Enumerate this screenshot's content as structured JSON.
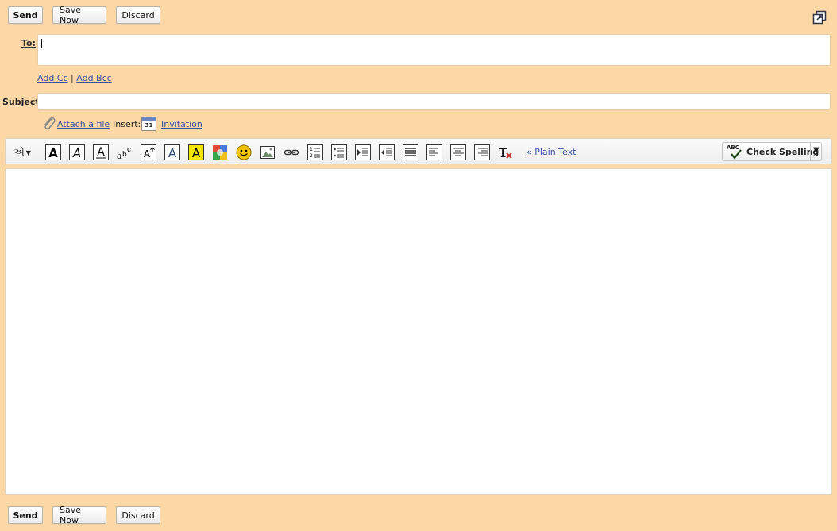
{
  "actions": {
    "send": "Send",
    "save_now": "Save Now",
    "discard": "Discard"
  },
  "to": {
    "label": "To:",
    "value": ""
  },
  "cc_bcc": {
    "add_cc": "Add Cc",
    "separator": "|",
    "add_bcc": "Add Bcc"
  },
  "subject": {
    "label": "Subject:",
    "value": ""
  },
  "attach": {
    "label": "Attach a file",
    "insert_label": "Insert:",
    "calendar_day": "31",
    "invitation": "Invitation"
  },
  "toolbar": {
    "plain_text": "« Plain Text",
    "check_spelling": "Check Spelling",
    "abc": "ABC",
    "icons": [
      "font-icon",
      "bold-icon",
      "italic-icon",
      "underline-icon",
      "font-face-icon",
      "font-size-icon",
      "text-color-icon",
      "highlight-color-icon",
      "picasa-icon",
      "emoticon-icon",
      "insert-image-icon",
      "link-icon",
      "numbered-list-icon",
      "bulleted-list-icon",
      "indent-more-icon",
      "indent-less-icon",
      "quote-icon",
      "align-left-icon",
      "align-center-icon",
      "align-right-icon",
      "remove-formatting-icon"
    ]
  },
  "body": {
    "value": ""
  },
  "colors": {
    "background": "#fdd8a7",
    "link": "#3a4fa1"
  }
}
